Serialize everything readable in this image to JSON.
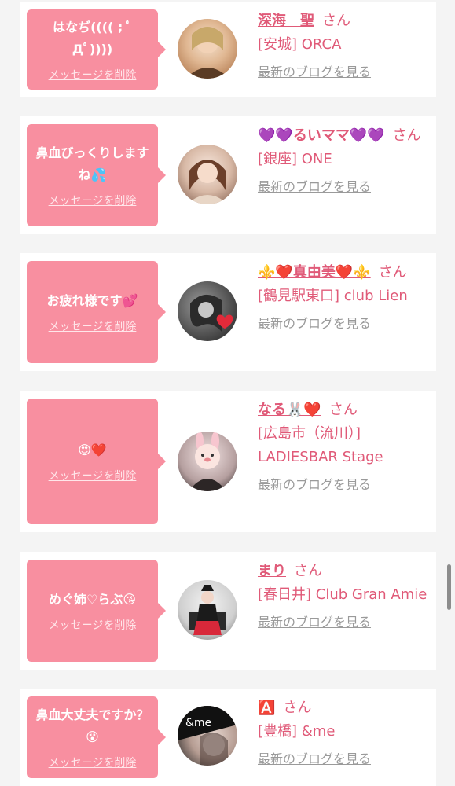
{
  "cards": [
    {
      "message": "はなぢ(((( ; ﾟДﾟ))))",
      "delete_label": "メッセージを削除",
      "name": "深海　聖",
      "san": "さん",
      "shop": "[安城] ORCA",
      "blog_link": "最新のブログを見る",
      "avatar_colors": [
        "#f0dcc4",
        "#c98a58"
      ]
    },
    {
      "message": "鼻血びっくりしますね💦",
      "delete_label": "メッセージを削除",
      "name": "💜💜るいママ💜💜",
      "san": "さん",
      "shop": "[銀座] ONE",
      "blog_link": "最新のブログを見る",
      "avatar_colors": [
        "#f3ddd0",
        "#6e4a3a"
      ]
    },
    {
      "message": "お疲れ様です💕",
      "delete_label": "メッセージを削除",
      "name": "⚜️❤️真由美❤️⚜️",
      "san": "さん",
      "shop": "[鶴見駅東口] club Lien",
      "blog_link": "最新のブログを見る",
      "avatar_colors": [
        "#8a8a8a",
        "#2e2e2e"
      ]
    },
    {
      "message": "😍❤️",
      "delete_label": "メッセージを削除",
      "name": "なる🐰❤️",
      "san": "さん",
      "shop": "[広島市（流川）] LADIESBAR Stage",
      "blog_link": "最新のブログを見る",
      "avatar_colors": [
        "#f7e7e7",
        "#3a3030"
      ]
    },
    {
      "message": "めぐ姉♡らぶ😘",
      "delete_label": "メッセージを削除",
      "name": "まり",
      "san": "さん",
      "shop": "[春日井] Club Gran Amie",
      "blog_link": "最新のブログを見る",
      "avatar_colors": [
        "#e9e9e9",
        "#2a2a2a"
      ]
    },
    {
      "message": "鼻血大丈夫ですか？😵",
      "delete_label": "メッセージを削除",
      "name": "🅰️",
      "san": "さん",
      "shop": "[豊橋] &me",
      "blog_link": "最新のブログを見る",
      "avatar_colors": [
        "#d9c7c0",
        "#1c1c1c"
      ],
      "avatar_label": "&me"
    }
  ]
}
